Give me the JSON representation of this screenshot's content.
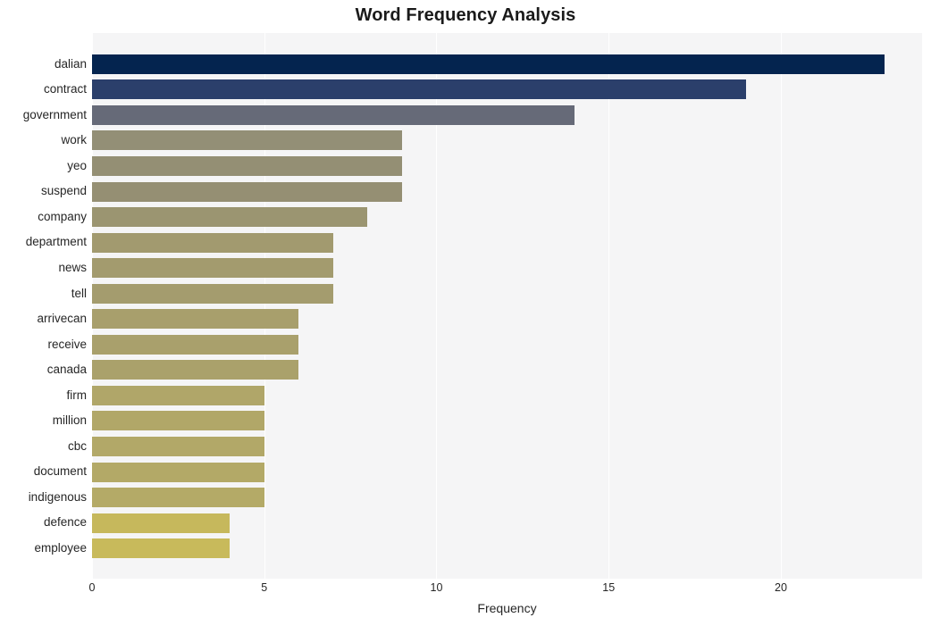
{
  "chart_data": {
    "type": "bar",
    "orientation": "horizontal",
    "title": "Word Frequency Analysis",
    "xlabel": "Frequency",
    "ylabel": "",
    "categories": [
      "dalian",
      "contract",
      "government",
      "work",
      "yeo",
      "suspend",
      "company",
      "department",
      "news",
      "tell",
      "arrivecan",
      "receive",
      "canada",
      "firm",
      "million",
      "cbc",
      "document",
      "indigenous",
      "defence",
      "employee"
    ],
    "values": [
      23,
      19,
      14,
      9,
      9,
      9,
      8,
      7,
      7,
      7,
      6,
      6,
      6,
      5,
      5,
      5,
      5,
      5,
      4,
      4
    ],
    "colors": [
      "#04244f",
      "#2b3f6b",
      "#666a78",
      "#938f76",
      "#948f74",
      "#958f73",
      "#9b9571",
      "#a29a6f",
      "#a39b6e",
      "#a49c6e",
      "#a89f6c",
      "#a9a06c",
      "#aaa16b",
      "#b0a669",
      "#b1a768",
      "#b2a868",
      "#b3a967",
      "#b4aa67",
      "#c6b85c",
      "#c8ba5b"
    ],
    "xlim": [
      0,
      24.1
    ],
    "xticks": [
      0,
      5,
      10,
      15,
      20
    ],
    "xticklabels": [
      "0",
      "5",
      "10",
      "15",
      "20"
    ],
    "gridlines_x": [
      0,
      5,
      10,
      15,
      20
    ],
    "grid": true,
    "grid_color": "#ffffff",
    "plot_background": "#f5f5f6",
    "figure_background": "#ffffff",
    "legend": null,
    "annotations": []
  }
}
